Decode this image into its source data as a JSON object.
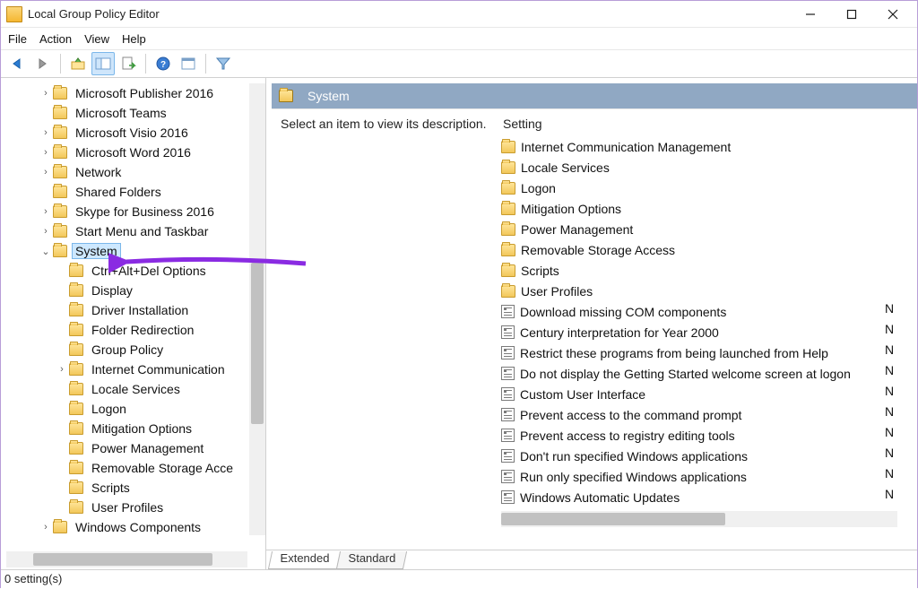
{
  "window": {
    "title": "Local Group Policy Editor"
  },
  "menus": {
    "file": "File",
    "action": "Action",
    "view": "View",
    "help": "Help"
  },
  "tree": {
    "items": [
      {
        "label": "Microsoft Publisher 2016",
        "expandable": true
      },
      {
        "label": "Microsoft Teams",
        "expandable": false
      },
      {
        "label": "Microsoft Visio 2016",
        "expandable": true
      },
      {
        "label": "Microsoft Word 2016",
        "expandable": true
      },
      {
        "label": "Network",
        "expandable": true
      },
      {
        "label": "Shared Folders",
        "expandable": false
      },
      {
        "label": "Skype for Business 2016",
        "expandable": true
      },
      {
        "label": "Start Menu and Taskbar",
        "expandable": true
      }
    ],
    "selected": {
      "label": "System",
      "expanded": true
    },
    "children": [
      {
        "label": "Ctrl+Alt+Del Options"
      },
      {
        "label": "Display"
      },
      {
        "label": "Driver Installation"
      },
      {
        "label": "Folder Redirection"
      },
      {
        "label": "Group Policy"
      },
      {
        "label": "Internet Communication",
        "expandable": true
      },
      {
        "label": "Locale Services"
      },
      {
        "label": "Logon"
      },
      {
        "label": "Mitigation Options"
      },
      {
        "label": "Power Management"
      },
      {
        "label": "Removable Storage Acce"
      },
      {
        "label": "Scripts"
      },
      {
        "label": "User Profiles"
      }
    ],
    "after": [
      {
        "label": "Windows Components",
        "expandable": true
      }
    ]
  },
  "right": {
    "header": "System",
    "description": "Select an item to view its description.",
    "column_header": "Setting",
    "folders": [
      "Internet Communication Management",
      "Locale Services",
      "Logon",
      "Mitigation Options",
      "Power Management",
      "Removable Storage Access",
      "Scripts",
      "User Profiles"
    ],
    "settings": [
      {
        "label": "Download missing COM components",
        "state": "N"
      },
      {
        "label": "Century interpretation for Year 2000",
        "state": "N"
      },
      {
        "label": "Restrict these programs from being launched from Help",
        "state": "N"
      },
      {
        "label": "Do not display the Getting Started welcome screen at logon",
        "state": "N"
      },
      {
        "label": "Custom User Interface",
        "state": "N"
      },
      {
        "label": "Prevent access to the command prompt",
        "state": "N"
      },
      {
        "label": "Prevent access to registry editing tools",
        "state": "N"
      },
      {
        "label": "Don't run specified Windows applications",
        "state": "N"
      },
      {
        "label": "Run only specified Windows applications",
        "state": "N"
      },
      {
        "label": "Windows Automatic Updates",
        "state": "N"
      }
    ]
  },
  "tabs": {
    "extended": "Extended",
    "standard": "Standard"
  },
  "status": {
    "text": "0 setting(s)"
  }
}
